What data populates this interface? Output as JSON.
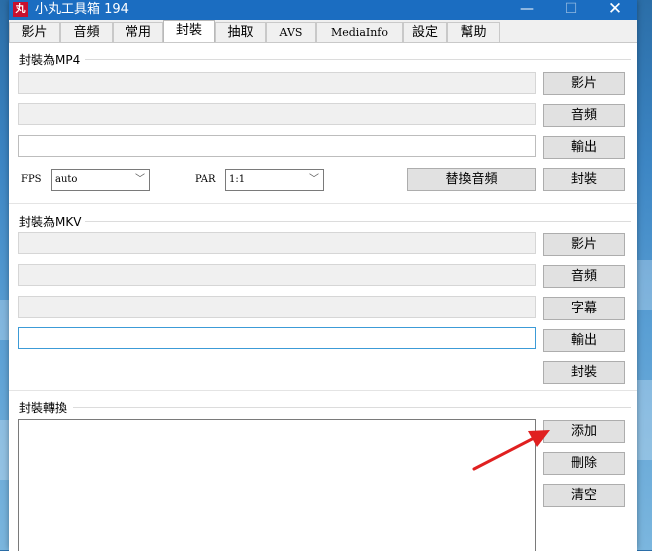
{
  "window": {
    "title": "小丸工具箱 194",
    "icon_text": "丸",
    "minimize_glyph": "—",
    "maximize_glyph": "☐",
    "close_glyph": "✕"
  },
  "tabs": [
    {
      "label": "影片"
    },
    {
      "label": "音頻"
    },
    {
      "label": "常用"
    },
    {
      "label": "封裝",
      "active": true
    },
    {
      "label": "抽取"
    },
    {
      "label": "AVS"
    },
    {
      "label": "MediaInfo"
    },
    {
      "label": "設定"
    },
    {
      "label": "幫助"
    }
  ],
  "mp4": {
    "group_label": "封裝為MP4",
    "video_button": "影片",
    "audio_button": "音頻",
    "output_button": "輸出",
    "fps_label": "FPS",
    "fps_value": "auto",
    "par_label": "PAR",
    "par_value": "1:1",
    "replace_audio_button": "替換音頻",
    "mux_button": "封裝"
  },
  "mkv": {
    "group_label": "封裝為MKV",
    "video_button": "影片",
    "audio_button": "音頻",
    "subtitle_button": "字幕",
    "output_button": "輸出",
    "mux_button": "封裝"
  },
  "convert": {
    "group_label": "封裝轉換",
    "add_button": "添加",
    "delete_button": "刪除",
    "clear_button": "清空"
  },
  "colors": {
    "titlebar": "#1b6dc1",
    "focus_border": "#3c9bd7",
    "annotation_arrow": "#e02020"
  }
}
